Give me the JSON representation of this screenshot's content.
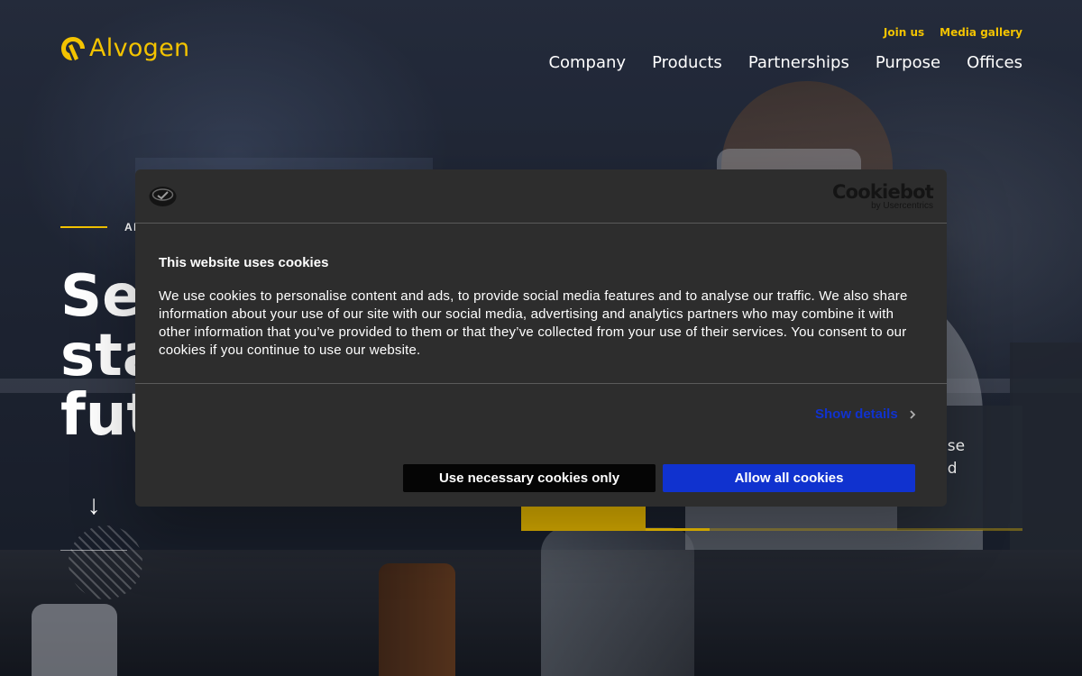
{
  "header": {
    "logo_text": "Alvogen",
    "top_links": [
      "Join us",
      "Media gallery"
    ],
    "nav": [
      "Company",
      "Products",
      "Partnerships",
      "Purpose",
      "Offices"
    ]
  },
  "hero": {
    "eyebrow": "AL",
    "title_lines": [
      "Se",
      "sta",
      "fut"
    ]
  },
  "news_card": {
    "lines": [
      "nse",
      "nd"
    ]
  },
  "cookie_dialog": {
    "brand_name": "Cookiebot",
    "brand_sub": "by Usercentrics",
    "title": "This website uses cookies",
    "body": "We use cookies to personalise content and ads, to provide social media features and to analyse our traffic. We also share information about your use of our site with our social media, advertising and analytics partners who may combine it with other information that you’ve provided to them or that they’ve collected from your use of their services. You consent to our cookies if you continue to use our website.",
    "show_details": "Show details",
    "necessary_button": "Use necessary cookies only",
    "allow_button": "Allow all cookies"
  },
  "colors": {
    "brand_yellow": "#f3c300",
    "dialog_bg": "#2d2d2d",
    "primary_button": "#1032cf",
    "secondary_button": "#050505"
  },
  "icons": {
    "logo": "alvogen-logo-icon",
    "cookiebot_badge": "cookie-badge-icon",
    "details": "chevron-right-icon",
    "scroll": "arrow-down-icon"
  }
}
